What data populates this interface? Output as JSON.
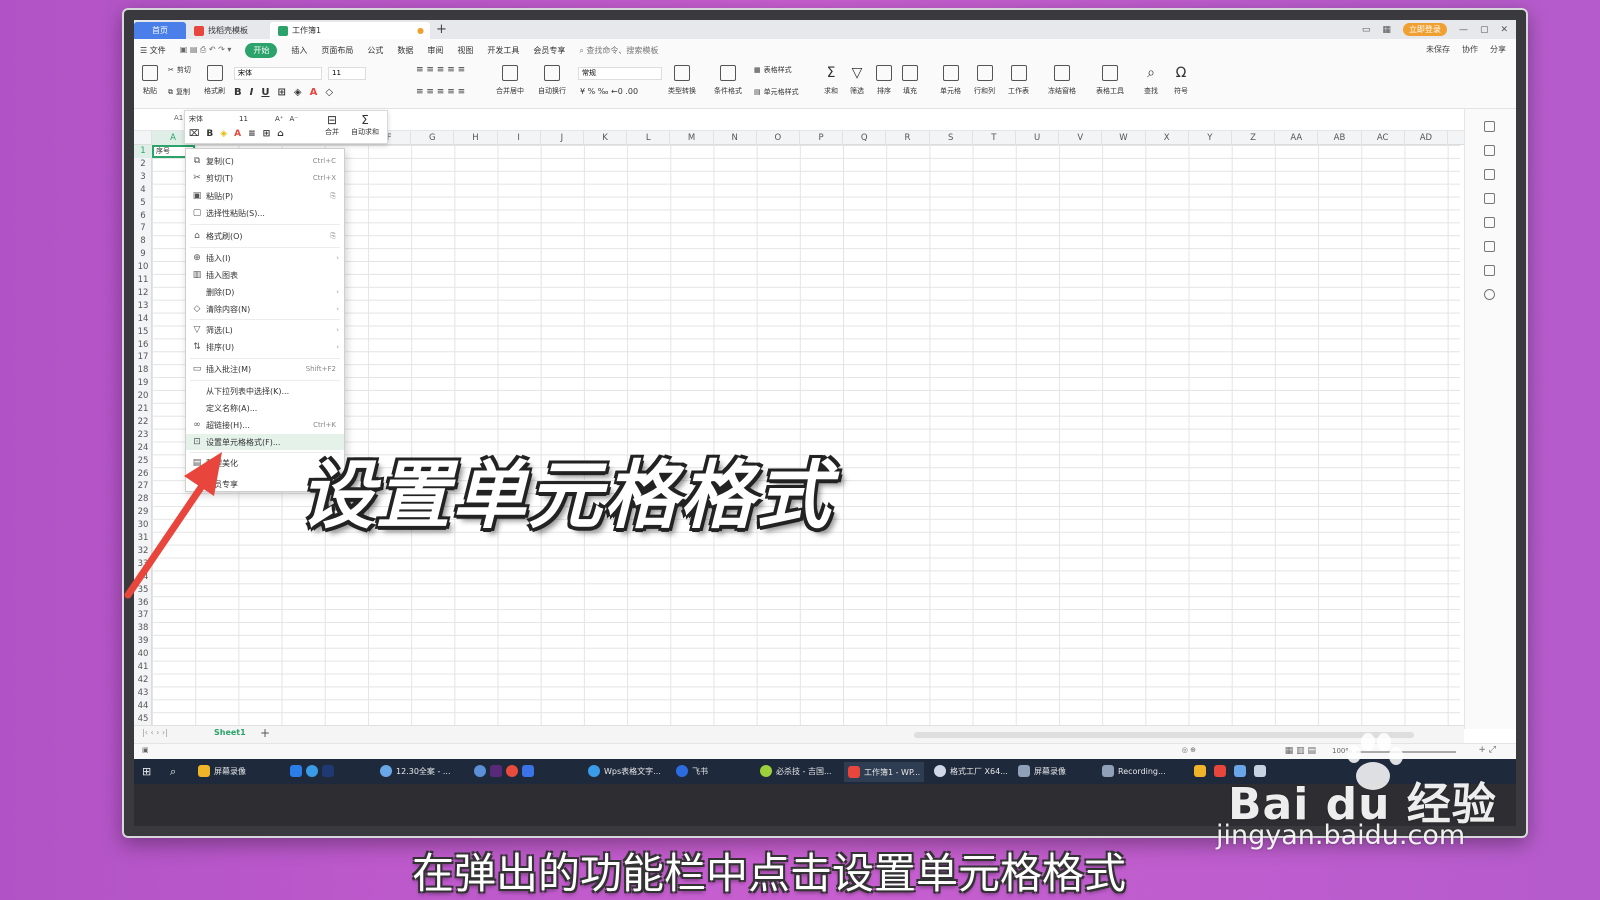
{
  "titlebar": {
    "tabs": [
      {
        "label": "首页"
      },
      {
        "label": "找稻壳模板"
      },
      {
        "label": "工作簿1"
      }
    ],
    "login_label": "立即登录"
  },
  "menubar": {
    "items": [
      "文件",
      "开始",
      "插入",
      "页面布局",
      "公式",
      "数据",
      "审阅",
      "视图",
      "开发工具",
      "会员专享"
    ],
    "search_placeholder": "查找命令、搜索模板",
    "right": [
      "未保存",
      "协作",
      "分享"
    ]
  },
  "ribbon": {
    "paste": "粘贴",
    "cut": "剪切",
    "copy": "复制",
    "format_painter": "格式刷",
    "font": "宋体",
    "size": "11",
    "merge_center": "合并居中",
    "wrap": "自动换行",
    "number_format": "常规",
    "type_convert": "类型转换",
    "cond_format": "条件格式",
    "table_style": "表格样式",
    "cell_style": "单元格样式",
    "sum": "求和",
    "filter": "筛选",
    "sort": "排序",
    "fill": "填充",
    "cell": "单元格",
    "row_col": "行和列",
    "worksheet": "工作表",
    "freeze": "冻结窗格",
    "table_tools": "表格工具",
    "find": "查找",
    "symbol": "符号"
  },
  "minibar": {
    "font": "宋体",
    "size": "11",
    "merge": "合并",
    "autosum": "自动求和"
  },
  "namebox": "A1",
  "cell_a1": "序号",
  "columns": [
    "A",
    "B",
    "C",
    "D",
    "E",
    "F",
    "G",
    "H",
    "I",
    "J",
    "K",
    "L",
    "M",
    "N",
    "O",
    "P",
    "Q",
    "R",
    "S",
    "T",
    "U",
    "V",
    "W",
    "X",
    "Y",
    "Z",
    "AA",
    "AB",
    "AC",
    "AD",
    "A"
  ],
  "rows": [
    "1",
    "2",
    "3",
    "4",
    "5",
    "6",
    "7",
    "8",
    "9",
    "10",
    "11",
    "12",
    "13",
    "14",
    "15",
    "16",
    "17",
    "18",
    "19",
    "20",
    "21",
    "22",
    "23",
    "24",
    "25",
    "26",
    "27",
    "28",
    "29",
    "30",
    "31",
    "32",
    "33",
    "34",
    "35",
    "36",
    "37",
    "38",
    "39",
    "40",
    "41",
    "42",
    "43",
    "44",
    "45"
  ],
  "context_menu": {
    "copy": "复制(C)",
    "copy_sc": "Ctrl+C",
    "cut": "剪切(T)",
    "cut_sc": "Ctrl+X",
    "paste": "粘贴(P)",
    "paste_special": "选择性粘贴(S)...",
    "format_painter": "格式刷(O)",
    "insert": "插入(I)",
    "insert_chart": "插入图表",
    "delete": "删除(D)",
    "clear": "清除内容(N)",
    "filter": "筛选(L)",
    "sort": "排序(U)",
    "insert_comment": "插入批注(M)",
    "comment_sc": "Shift+F2",
    "pick_list": "从下拉列表中选择(K)...",
    "define_name": "定义名称(A)...",
    "hyperlink": "超链接(H)...",
    "hyperlink_sc": "Ctrl+K",
    "format_cells": "设置单元格格式(F)...",
    "beautify": "整理美化",
    "member": "会员专享"
  },
  "sheet_tab": "Sheet1",
  "status": {
    "zoom": "100%"
  },
  "taskbar": [
    {
      "label": "屏幕录像"
    },
    {
      "label": "12.30全案 - ..."
    },
    {
      "label": "Wps表格文字..."
    },
    {
      "label": "飞书"
    },
    {
      "label": "必杀技 - 吉国..."
    },
    {
      "label": "工作簿1 - WP..."
    },
    {
      "label": "格式工厂 X64..."
    },
    {
      "label": "屏幕录像"
    },
    {
      "label": "Recording..."
    }
  ],
  "overlay_title": "设置单元格格式",
  "subtitle": "在弹出的功能栏中点击设置单元格格式",
  "watermark": {
    "brand": "Bai du 经验",
    "url": "jingyan.baidu.com"
  },
  "colors": {
    "accent_green": "#2ba36a",
    "home_tab_blue": "#4a7ee8",
    "arrow_red": "#e8453c",
    "background_purple": "#c05ccd"
  }
}
